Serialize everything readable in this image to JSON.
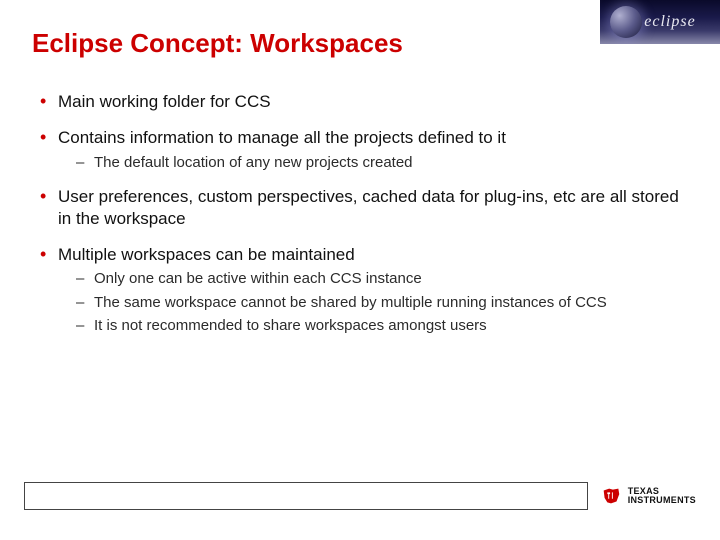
{
  "title": "Eclipse Concept: Workspaces",
  "logo": {
    "text": "eclipse"
  },
  "bullets": [
    {
      "text": "Main working folder for CCS",
      "sub": []
    },
    {
      "text": "Contains information to manage all the projects defined to it",
      "sub": [
        {
          "text": "The default location of any new projects created"
        }
      ]
    },
    {
      "text": "User preferences, custom perspectives, cached data for plug-ins, etc are all stored in the workspace",
      "sub": []
    },
    {
      "text": "Multiple workspaces can be maintained",
      "sub": [
        {
          "text": "Only one can be active within each CCS instance"
        },
        {
          "text": "The same workspace cannot be shared by multiple running instances of CCS"
        },
        {
          "text": "It is not recommended to share workspaces amongst users"
        }
      ]
    }
  ],
  "footer": {
    "brand_line1": "TEXAS",
    "brand_line2": "INSTRUMENTS"
  }
}
